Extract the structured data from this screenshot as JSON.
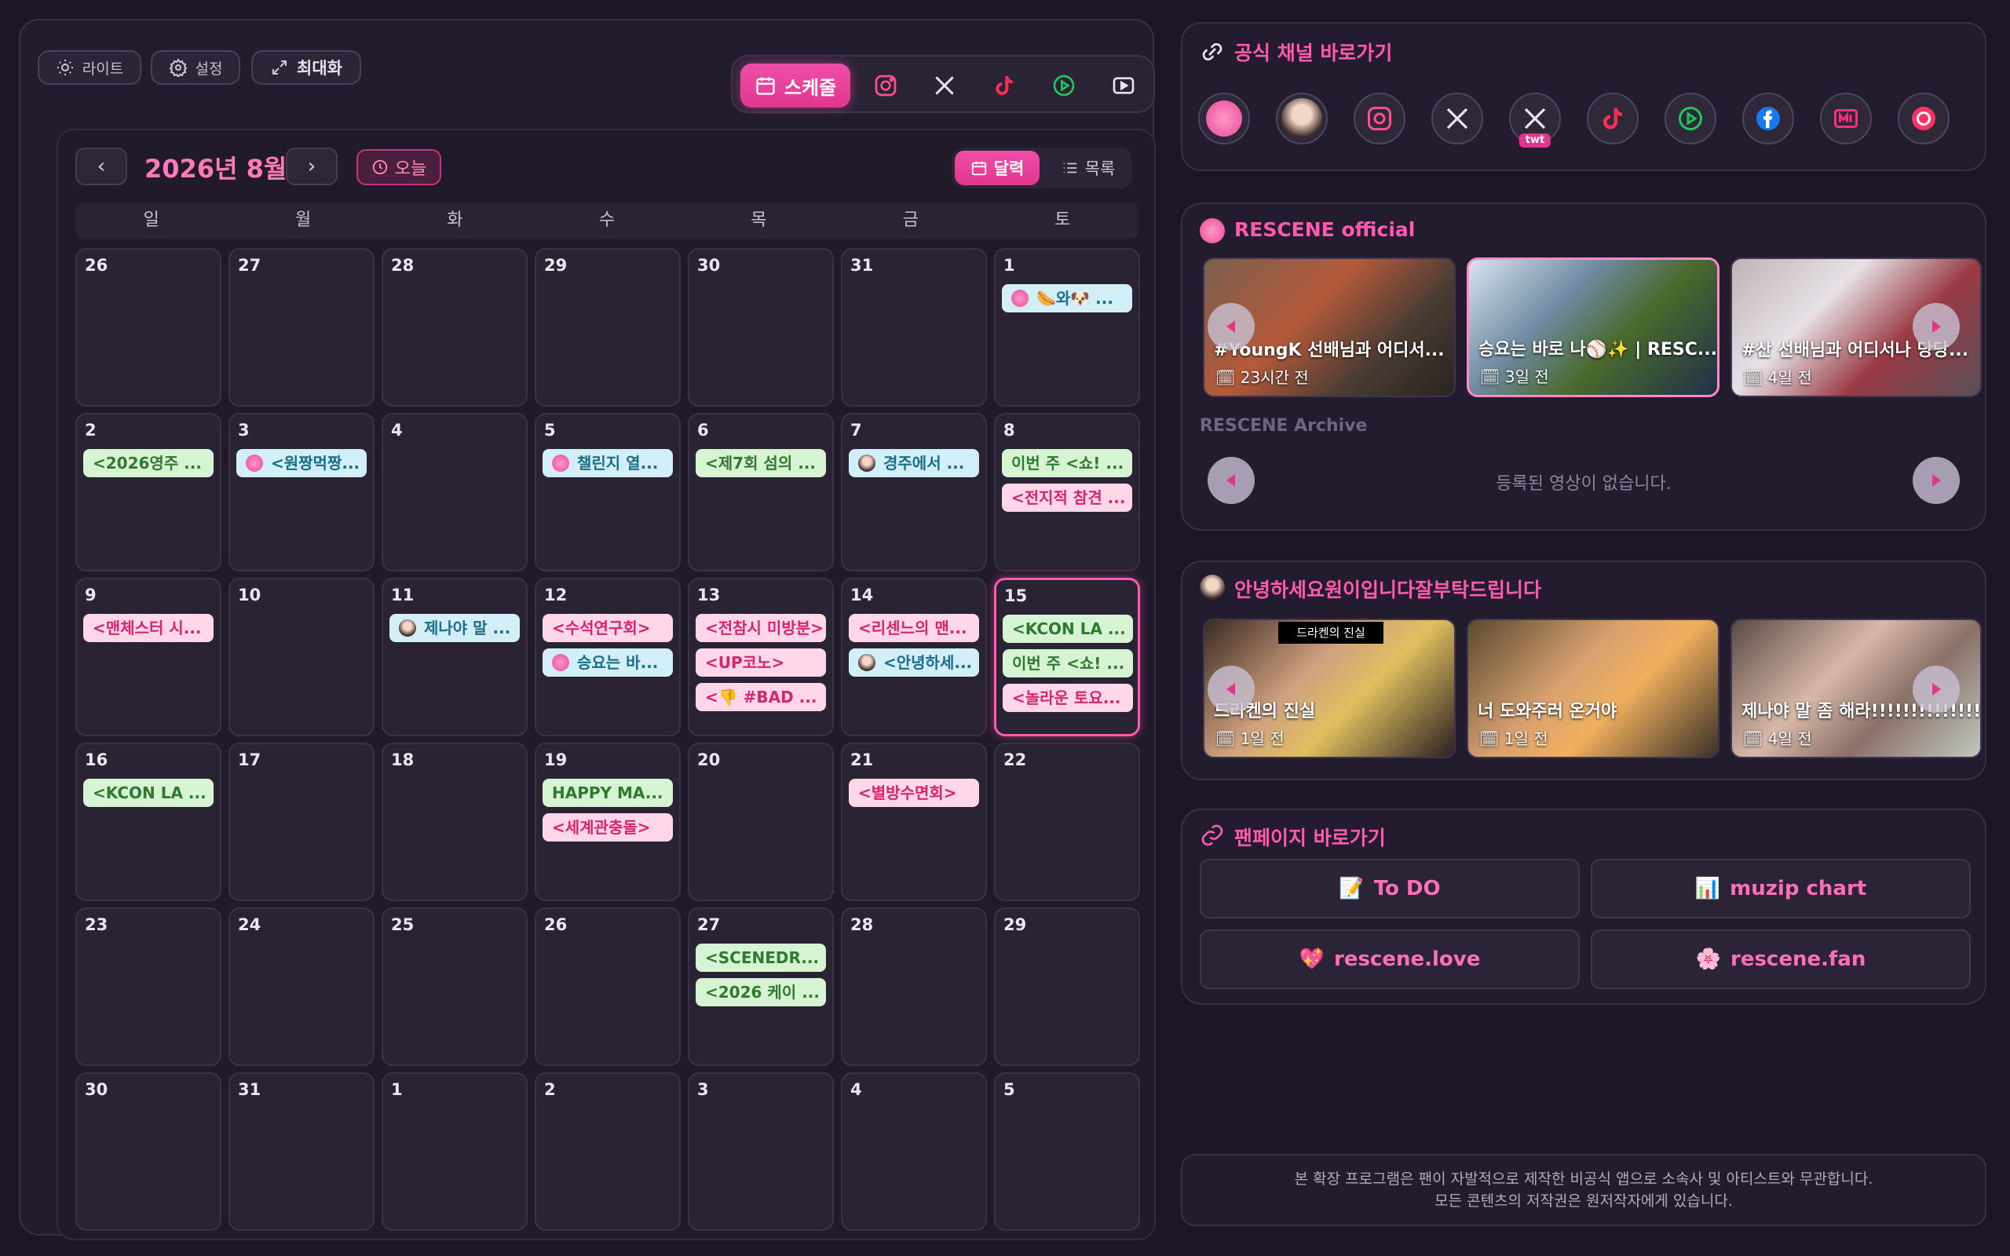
{
  "toolbar": {
    "light_label": "라이트",
    "settings_label": "설정",
    "maximize_label": "최대화"
  },
  "view_switch": {
    "schedule_label": "스케줄",
    "icons": [
      "calendar-icon",
      "instagram-icon",
      "x-icon",
      "tiktok-icon",
      "play-circle-icon",
      "youtube-play-icon"
    ]
  },
  "calendar": {
    "month_title": "2026년 8월",
    "today_label": "오늘",
    "mode_calendar_label": "달력",
    "mode_list_label": "목록",
    "weekdays": [
      "일",
      "월",
      "화",
      "수",
      "목",
      "금",
      "토"
    ],
    "days": [
      "26",
      "27",
      "28",
      "29",
      "30",
      "31",
      "1",
      "2",
      "3",
      "4",
      "5",
      "6",
      "7",
      "8",
      "9",
      "10",
      "11",
      "12",
      "13",
      "14",
      "15",
      "16",
      "17",
      "18",
      "19",
      "20",
      "21",
      "22",
      "23",
      "24",
      "25",
      "26",
      "27",
      "28",
      "29",
      "30",
      "31",
      "1",
      "2",
      "3",
      "4",
      "5"
    ],
    "events": {
      "d1": [
        {
          "text": "🌭와🐶 ...",
          "color": "blue",
          "avatar": "brand"
        }
      ],
      "d2": [
        {
          "text": "<2026영주 ...",
          "color": "green"
        }
      ],
      "d3": [
        {
          "text": "<원짱먹짱...",
          "color": "blue",
          "avatar": "brand"
        }
      ],
      "d5": [
        {
          "text": "챌린지 열...",
          "color": "blue",
          "avatar": "brand"
        }
      ],
      "d6": [
        {
          "text": "<제7회 섬의 ...",
          "color": "green"
        }
      ],
      "d7": [
        {
          "text": "경주에서 ...",
          "color": "blue",
          "avatar": "photo"
        }
      ],
      "d8": [
        {
          "text": "이번 주 <쇼! ...",
          "color": "green"
        },
        {
          "text": "<전지적 참견 ...",
          "color": "pink"
        }
      ],
      "d9": [
        {
          "text": "<맨체스터 시...",
          "color": "pink"
        }
      ],
      "d11": [
        {
          "text": "제나야 말 ...",
          "color": "blue",
          "avatar": "photo"
        }
      ],
      "d12": [
        {
          "text": "<수석연구회>",
          "color": "pink"
        },
        {
          "text": "승요는 바...",
          "color": "blue",
          "avatar": "brand"
        }
      ],
      "d13": [
        {
          "text": "<전참시 미방분>",
          "color": "pink"
        },
        {
          "text": "<UP코노>",
          "color": "pink"
        },
        {
          "text": "<👎 #BAD ...",
          "color": "pink"
        }
      ],
      "d14": [
        {
          "text": "<리센느의 맨...",
          "color": "pink"
        },
        {
          "text": "<안녕하세...",
          "color": "blue",
          "avatar": "photo"
        }
      ],
      "d15": [
        {
          "text": "<KCON LA ...",
          "color": "green"
        },
        {
          "text": "이번 주 <쇼! ...",
          "color": "green"
        },
        {
          "text": "<놀라운 토요...",
          "color": "pink"
        }
      ],
      "d16": [
        {
          "text": "<KCON LA ...",
          "color": "green"
        }
      ],
      "d19": [
        {
          "text": "HAPPY MA...",
          "color": "green"
        },
        {
          "text": "<세계관충돌>",
          "color": "pink"
        }
      ],
      "d21": [
        {
          "text": "<별방수면회>",
          "color": "pink"
        }
      ],
      "d27": [
        {
          "text": "<SCENEDR...",
          "color": "green"
        },
        {
          "text": "<2026 케이 ...",
          "color": "green"
        }
      ]
    }
  },
  "official_channels": {
    "title": "공식 채널 바로가기",
    "items": [
      "rescene-logo-icon",
      "member-avatar-icon",
      "instagram-icon",
      "x-icon",
      "x-twt-icon",
      "tiktok-icon",
      "play-circle-icon",
      "facebook-icon",
      "mnet-icon",
      "melon-icon"
    ],
    "twt_badge": "twt"
  },
  "rescene_official": {
    "title": "RESCENE official",
    "videos": [
      {
        "title": "#YoungK 선배님과 어디서...",
        "date": "23시간 전"
      },
      {
        "title": "승요는 바로 나⚾✨ | RESC...",
        "date": "3일 전"
      },
      {
        "title": "#산 선배님과 어디서나 당당...",
        "date": "4일 전"
      }
    ],
    "archive_title": "RESCENE Archive",
    "archive_empty": "등록된 영상이 없습니다."
  },
  "member_channel": {
    "title": "안녕하세요원이입니다잘부탁드립니다",
    "videos": [
      {
        "title": "드라켄의 진실",
        "date": "1일 전",
        "overlay": "드라켄의 진실"
      },
      {
        "title": "너 도와주러 온거야",
        "date": "1일 전"
      },
      {
        "title": "제나야 말 좀 해라!!!!!!!!!!!!!!",
        "date": "4일 전"
      }
    ]
  },
  "fan_pages": {
    "title": "팬페이지 바로가기",
    "buttons": [
      {
        "emoji": "📝",
        "label": "To DO"
      },
      {
        "emoji": "📊",
        "label": "muzip chart"
      },
      {
        "emoji": "💖",
        "label": "rescene.love"
      },
      {
        "emoji": "🌸",
        "label": "rescene.fan"
      }
    ]
  },
  "footer": {
    "line1": "본 확장 프로그램은 팬이 자발적으로 제작한 비공식 앱으로 소속사 및 아티스트와 무관합니다.",
    "line2": "모든 콘텐츠의 저작권은 원저작자에게 있습니다."
  },
  "colors": {
    "accent": "#ff5aae",
    "background": "#1c1626",
    "panel": "#231c2e",
    "event_green": "#d6f3d3",
    "event_blue": "#d2eef6",
    "event_pink": "#ffd7e8"
  }
}
